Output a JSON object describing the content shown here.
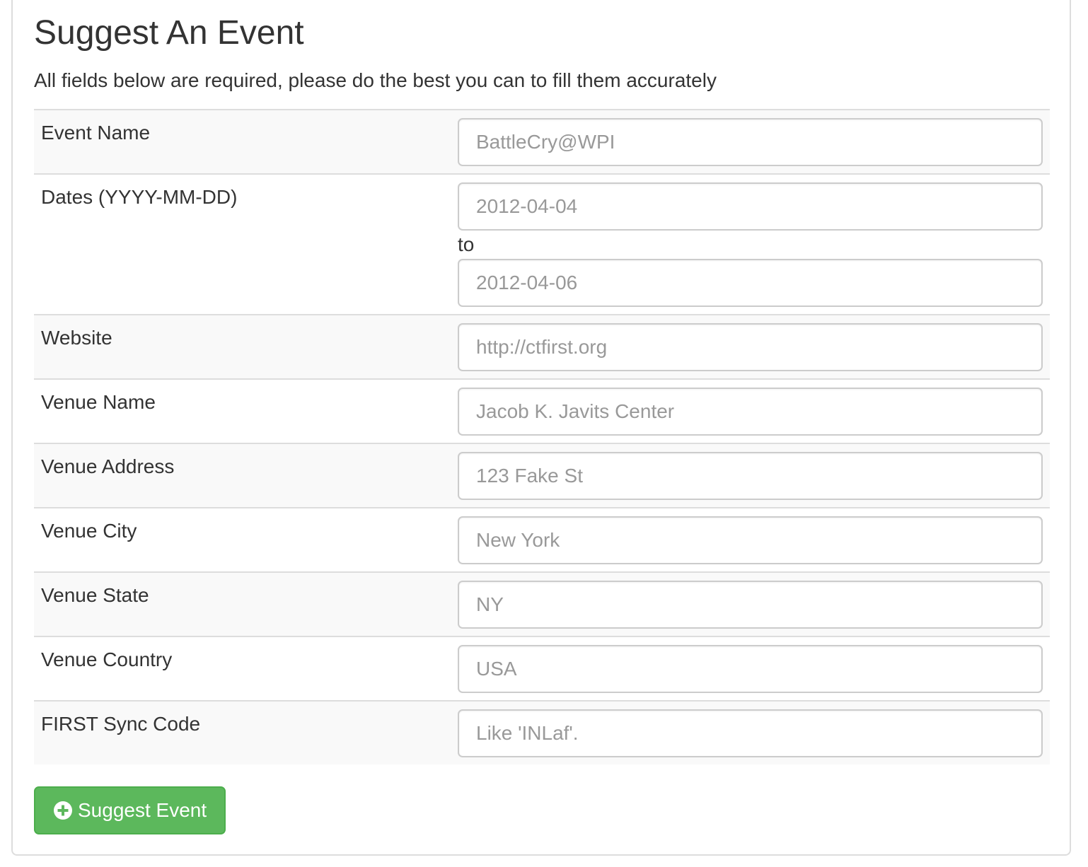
{
  "page": {
    "title": "Suggest An Event",
    "intro": "All fields below are required, please do the best you can to fill them accurately"
  },
  "form": {
    "event_name": {
      "label": "Event Name",
      "placeholder": "BattleCry@WPI",
      "value": ""
    },
    "dates": {
      "label": "Dates (YYYY-MM-DD)",
      "start_placeholder": "2012-04-04",
      "separator": "to",
      "end_placeholder": "2012-04-06"
    },
    "website": {
      "label": "Website",
      "placeholder": "http://ctfirst.org",
      "value": ""
    },
    "venue_name": {
      "label": "Venue Name",
      "placeholder": "Jacob K. Javits Center",
      "value": ""
    },
    "venue_address": {
      "label": "Venue Address",
      "placeholder": "123 Fake St",
      "value": ""
    },
    "venue_city": {
      "label": "Venue City",
      "placeholder": "New York",
      "value": ""
    },
    "venue_state": {
      "label": "Venue State",
      "placeholder": "NY",
      "value": ""
    },
    "venue_country": {
      "label": "Venue Country",
      "placeholder": "USA",
      "value": ""
    },
    "first_sync_code": {
      "label": "FIRST Sync Code",
      "placeholder": "Like 'INLaf'.",
      "value": ""
    }
  },
  "submit": {
    "label": "Suggest Event",
    "icon": "plus-circle-icon",
    "color": "#5cb85c"
  }
}
